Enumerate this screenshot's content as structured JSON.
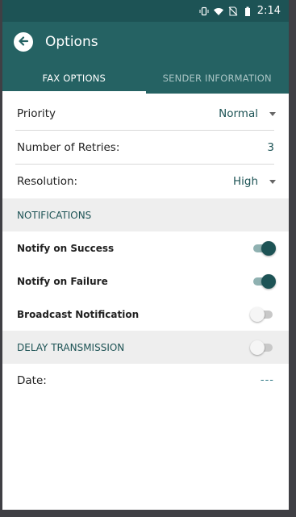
{
  "statusbar": {
    "time": "2:14"
  },
  "appbar": {
    "title": "Options"
  },
  "tabs": [
    {
      "label": "FAX OPTIONS",
      "active": true
    },
    {
      "label": "SENDER INFORMATION",
      "active": false
    }
  ],
  "fax_options": {
    "priority": {
      "label": "Priority",
      "value": "Normal"
    },
    "retries": {
      "label": "Number of Retries:",
      "value": "3"
    },
    "resolution": {
      "label": "Resolution:",
      "value": "High"
    }
  },
  "notifications": {
    "header": "NOTIFICATIONS",
    "items": [
      {
        "label": "Notify on Success",
        "on": true
      },
      {
        "label": "Notify on Failure",
        "on": true
      },
      {
        "label": "Broadcast Notification",
        "on": false
      }
    ]
  },
  "delay": {
    "header": "DELAY TRANSMISSION",
    "on": false,
    "date": {
      "label": "Date:",
      "value": "---"
    }
  },
  "colors": {
    "primary": "#256263",
    "primary_dark": "#1d5355",
    "section_bg": "#eeeeee"
  }
}
